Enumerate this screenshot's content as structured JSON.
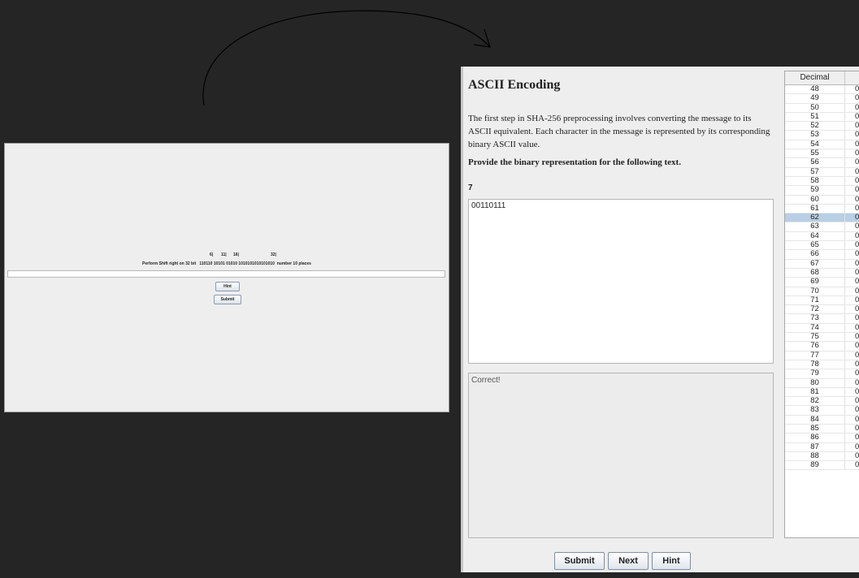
{
  "left_window": {
    "markers": [
      "6|",
      "11|",
      "16|",
      "32|"
    ],
    "prompt": "Perform Shift right on 32 bit   110110 10101 01010 1010101010101010  number 10 places",
    "answer_value": "",
    "hint_label": "Hint",
    "submit_label": "Submit"
  },
  "right_window": {
    "heading": "ASCII Encoding",
    "description": "The first step in SHA-256 preprocessing involves converting the message to its ASCII equivalent. Each character in the message is represented by its corresponding binary ASCII value.",
    "instruction": "Provide the binary representation for the following text.",
    "question_text": "7",
    "input_value": "00110111",
    "feedback": "Correct!",
    "buttons": {
      "submit": "Submit",
      "next": "Next",
      "hint": "Hint"
    },
    "table": {
      "header": "Decimal",
      "selected": "62",
      "rows": [
        {
          "dec": "48",
          "bin": "0"
        },
        {
          "dec": "49",
          "bin": "0"
        },
        {
          "dec": "50",
          "bin": "0"
        },
        {
          "dec": "51",
          "bin": "0"
        },
        {
          "dec": "52",
          "bin": "0"
        },
        {
          "dec": "53",
          "bin": "0"
        },
        {
          "dec": "54",
          "bin": "0"
        },
        {
          "dec": "55",
          "bin": "0"
        },
        {
          "dec": "56",
          "bin": "0"
        },
        {
          "dec": "57",
          "bin": "0"
        },
        {
          "dec": "58",
          "bin": "0"
        },
        {
          "dec": "59",
          "bin": "0"
        },
        {
          "dec": "60",
          "bin": "0"
        },
        {
          "dec": "61",
          "bin": "0"
        },
        {
          "dec": "62",
          "bin": "0"
        },
        {
          "dec": "63",
          "bin": "0"
        },
        {
          "dec": "64",
          "bin": "0"
        },
        {
          "dec": "65",
          "bin": "0"
        },
        {
          "dec": "66",
          "bin": "0"
        },
        {
          "dec": "67",
          "bin": "0"
        },
        {
          "dec": "68",
          "bin": "0"
        },
        {
          "dec": "69",
          "bin": "0"
        },
        {
          "dec": "70",
          "bin": "0"
        },
        {
          "dec": "71",
          "bin": "0"
        },
        {
          "dec": "72",
          "bin": "0"
        },
        {
          "dec": "73",
          "bin": "0"
        },
        {
          "dec": "74",
          "bin": "0"
        },
        {
          "dec": "75",
          "bin": "0"
        },
        {
          "dec": "76",
          "bin": "0"
        },
        {
          "dec": "77",
          "bin": "0"
        },
        {
          "dec": "78",
          "bin": "0"
        },
        {
          "dec": "79",
          "bin": "0"
        },
        {
          "dec": "80",
          "bin": "0"
        },
        {
          "dec": "81",
          "bin": "0"
        },
        {
          "dec": "82",
          "bin": "0"
        },
        {
          "dec": "83",
          "bin": "0"
        },
        {
          "dec": "84",
          "bin": "0"
        },
        {
          "dec": "85",
          "bin": "0"
        },
        {
          "dec": "86",
          "bin": "0"
        },
        {
          "dec": "87",
          "bin": "0"
        },
        {
          "dec": "88",
          "bin": "0"
        },
        {
          "dec": "89",
          "bin": "0"
        }
      ]
    }
  },
  "colors": {
    "background": "#252525",
    "panel": "#eeeeee",
    "selected_row": "#b8cfe5"
  }
}
